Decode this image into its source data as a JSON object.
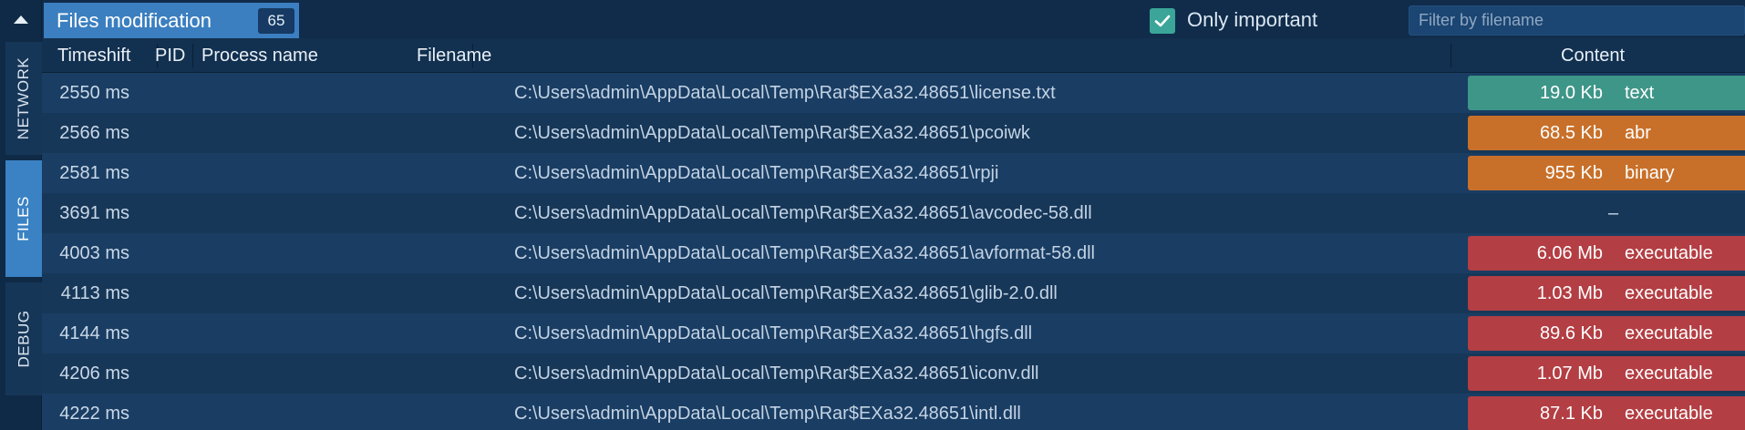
{
  "rail": {
    "tabs": [
      {
        "label": "NETWORK",
        "active": false
      },
      {
        "label": "FILES",
        "active": true
      },
      {
        "label": "DEBUG",
        "active": false
      }
    ]
  },
  "header": {
    "title": "Files modification",
    "count": "65",
    "only_important_label": "Only important",
    "only_important_checked": true,
    "filter_placeholder": "Filter by filename",
    "filter_value": ""
  },
  "table": {
    "columns": [
      "Timeshift",
      "PID",
      "Process name",
      "Filename",
      "Content"
    ],
    "rows": [
      {
        "time": "2550 ms",
        "pid": "",
        "process": "",
        "filename": "C:\\Users\\admin\\AppData\\Local\\Temp\\Rar$EXa32.48651\\license.txt",
        "size": "19.0 Kb",
        "type": "text",
        "color": "#3e9688"
      },
      {
        "time": "2566 ms",
        "pid": "",
        "process": "",
        "filename": "C:\\Users\\admin\\AppData\\Local\\Temp\\Rar$EXa32.48651\\pcoiwk",
        "size": "68.5 Kb",
        "type": "abr",
        "color": "#c8702a"
      },
      {
        "time": "2581 ms",
        "pid": "",
        "process": "",
        "filename": "C:\\Users\\admin\\AppData\\Local\\Temp\\Rar$EXa32.48651\\rpji",
        "size": "955 Kb",
        "type": "binary",
        "color": "#c8702a"
      },
      {
        "time": "3691 ms",
        "pid": "",
        "process": "",
        "filename": "C:\\Users\\admin\\AppData\\Local\\Temp\\Rar$EXa32.48651\\avcodec-58.dll",
        "size": "",
        "type": "",
        "color": "",
        "empty_text": "–"
      },
      {
        "time": "4003 ms",
        "pid": "",
        "process": "",
        "filename": "C:\\Users\\admin\\AppData\\Local\\Temp\\Rar$EXa32.48651\\avformat-58.dll",
        "size": "6.06 Mb",
        "type": "executable",
        "color": "#b33e43"
      },
      {
        "time": "4113 ms",
        "pid": "",
        "process": "",
        "filename": "C:\\Users\\admin\\AppData\\Local\\Temp\\Rar$EXa32.48651\\glib-2.0.dll",
        "size": "1.03 Mb",
        "type": "executable",
        "color": "#b33e43"
      },
      {
        "time": "4144 ms",
        "pid": "",
        "process": "",
        "filename": "C:\\Users\\admin\\AppData\\Local\\Temp\\Rar$EXa32.48651\\hgfs.dll",
        "size": "89.6 Kb",
        "type": "executable",
        "color": "#b33e43"
      },
      {
        "time": "4206 ms",
        "pid": "",
        "process": "",
        "filename": "C:\\Users\\admin\\AppData\\Local\\Temp\\Rar$EXa32.48651\\iconv.dll",
        "size": "1.07 Mb",
        "type": "executable",
        "color": "#b33e43"
      },
      {
        "time": "4222 ms",
        "pid": "",
        "process": "",
        "filename": "C:\\Users\\admin\\AppData\\Local\\Temp\\Rar$EXa32.48651\\intl.dll",
        "size": "87.1 Kb",
        "type": "executable",
        "color": "#b33e43"
      }
    ]
  }
}
